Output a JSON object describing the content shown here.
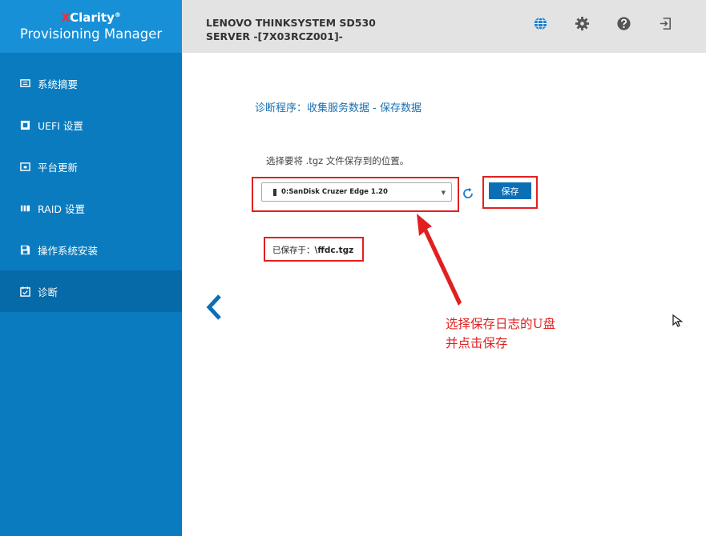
{
  "brand": {
    "line1_x": "X",
    "line1_rest": "Clarity",
    "tm": "®",
    "line2": "Provisioning Manager"
  },
  "sidebar": {
    "items": [
      {
        "label": "系统摘要",
        "icon": "summary-icon"
      },
      {
        "label": "UEFI 设置",
        "icon": "uefi-settings-icon"
      },
      {
        "label": "平台更新",
        "icon": "platform-update-icon"
      },
      {
        "label": "RAID 设置",
        "icon": "raid-icon"
      },
      {
        "label": "操作系统安装",
        "icon": "floppy-disk-icon"
      },
      {
        "label": "诊断",
        "icon": "calendar-check-icon",
        "active": true
      }
    ]
  },
  "header": {
    "server_title": "LENOVO THINKSYSTEM SD530 SERVER -[7X03RCZ001]-",
    "icons": [
      "globe-icon",
      "gear-icon",
      "help-icon",
      "logout-icon"
    ]
  },
  "main": {
    "page_title": "诊断程序：收集服务数据 - 保存数据",
    "instruction": "选择要将 .tgz 文件保存到的位置。",
    "device_select": "0:SanDisk Cruzer Edge 1.20",
    "save_button": "保存",
    "saved_label": "已保存于：",
    "saved_path": "\\ffdc.tgz",
    "annotation_line1": "选择保存日志的U盘",
    "annotation_line2": "并点击保存"
  },
  "colors": {
    "sidebar_bg": "#0a7bbf",
    "brand_bg": "#1890d8",
    "active_item": "#0669a8",
    "header_bg": "#e3e3e3",
    "accent": "#1a6fb0",
    "annotation_red": "#e02020"
  }
}
